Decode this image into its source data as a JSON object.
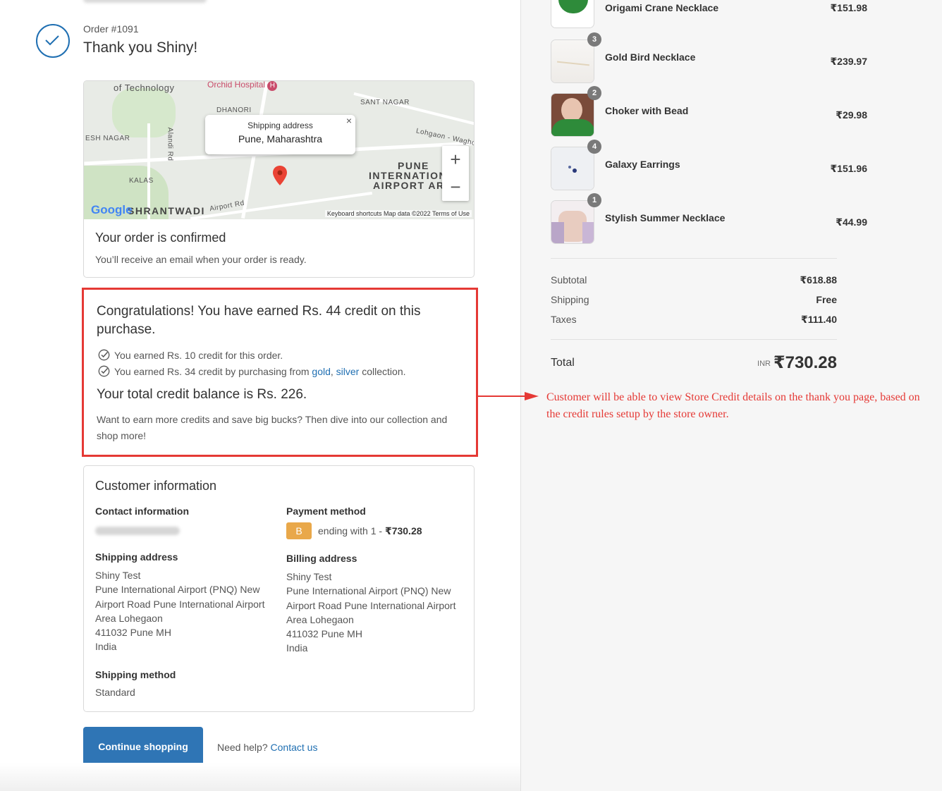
{
  "header": {
    "order_number": "Order #1091",
    "thank_you": "Thank you Shiny!"
  },
  "map": {
    "popup_label": "Shipping address",
    "popup_value": "Pune, Maharashtra",
    "hospital": "Orchid Hospital",
    "labels": [
      "of Technology",
      "DHANORI",
      "SANT NAGAR",
      "ESH NAGAR",
      "KALAS",
      "Lohgaon - Wagholi R",
      "Airport Rd",
      "Alandi Rd"
    ],
    "airport_lines": [
      "PUNE",
      "INTERNATION",
      "AIRPORT ARE"
    ],
    "district": "SHRANTWADI",
    "google": "Google",
    "footer": "Keyboard shortcuts    Map data ©2022    Terms of Use",
    "zoom_in": "+",
    "zoom_out": "−"
  },
  "confirmation": {
    "heading": "Your order is confirmed",
    "text": "You’ll receive an email when your order is ready."
  },
  "credit": {
    "heading": "Congratulations! You have earned Rs. 44 credit on this purchase.",
    "line1": "You earned Rs. 10 credit for this order.",
    "line2_prefix": "You earned Rs. 34 credit by purchasing from",
    "link_gold": "gold",
    "comma": ",",
    "link_silver": "silver",
    "line2_suffix": "collection.",
    "balance": "Your total credit balance is Rs. 226.",
    "more": "Want to earn more credits and save big bucks? Then dive into our collection and shop more!"
  },
  "customer": {
    "title": "Customer information",
    "contact_label": "Contact information",
    "payment_label": "Payment method",
    "payment_badge": "B",
    "payment_text": "ending with 1 -",
    "payment_amount": "₹730.28",
    "shipping_label": "Shipping address",
    "shipping_lines": [
      "Shiny Test",
      "Pune International Airport (PNQ) New",
      "Airport Road Pune International Airport",
      "Area Lohegaon",
      "411032 Pune MH",
      "India"
    ],
    "billing_label": "Billing address",
    "billing_lines": [
      "Shiny Test",
      "Pune International Airport (PNQ) New",
      "Airport Road Pune International Airport",
      "Area Lohegaon",
      "411032 Pune MH",
      "India"
    ],
    "method_label": "Shipping method",
    "method_value": "Standard"
  },
  "actions": {
    "continue": "Continue shopping",
    "help_text": "Need help?",
    "contact": "Contact us"
  },
  "items": [
    {
      "name": "Origami Crane Necklace",
      "price": "₹151.98",
      "qty": ""
    },
    {
      "name": "Gold Bird Necklace",
      "price": "₹239.97",
      "qty": "3"
    },
    {
      "name": "Choker with Bead",
      "price": "₹29.98",
      "qty": "2"
    },
    {
      "name": "Galaxy Earrings",
      "price": "₹151.96",
      "qty": "4"
    },
    {
      "name": "Stylish Summer Necklace",
      "price": "₹44.99",
      "qty": "1"
    }
  ],
  "summary": {
    "subtotal_label": "Subtotal",
    "subtotal": "₹618.88",
    "shipping_label": "Shipping",
    "shipping": "Free",
    "taxes_label": "Taxes",
    "taxes": "₹111.40",
    "total_label": "Total",
    "currency": "INR",
    "total": "₹730.28"
  },
  "annotation": {
    "text": "Customer will be able to view Store Credit details on the thank you page, based on the credit rules setup by the store owner."
  },
  "colors": {
    "accent": "#2f75b5",
    "annotation": "#e53935",
    "payment_badge": "#e9a84a"
  }
}
